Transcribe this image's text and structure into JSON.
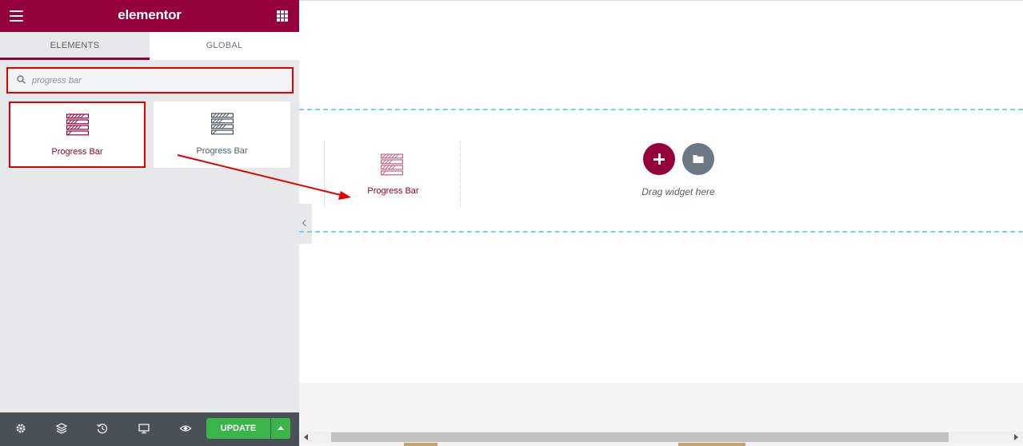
{
  "header": {
    "logo": "elementor",
    "menu_icon": "hamburger-icon",
    "apps_icon": "grid-icon",
    "brand_color": "#93003c"
  },
  "tabs": [
    {
      "label": "ELEMENTS",
      "active": true
    },
    {
      "label": "GLOBAL",
      "active": false
    }
  ],
  "search": {
    "value": "progress bar",
    "icon": "search-icon"
  },
  "widgets": [
    {
      "label": "Progress Bar",
      "icon": "progress-bar-icon",
      "highlighted": true
    },
    {
      "label": "Progress Bar",
      "icon": "progress-bar-icon",
      "highlighted": false
    }
  ],
  "footer": {
    "icons": [
      "settings-icon",
      "layers-icon",
      "history-icon",
      "responsive-icon",
      "preview-icon"
    ],
    "update_label": "UPDATE",
    "update_color": "#39b54a"
  },
  "canvas": {
    "dragged_widget_label": "Progress Bar",
    "drag_hint": "Drag widget here",
    "add_icon": "plus-icon",
    "template_icon": "folder-icon",
    "dashed_color": "#71d7e3"
  },
  "annotation_color": "#e00000"
}
